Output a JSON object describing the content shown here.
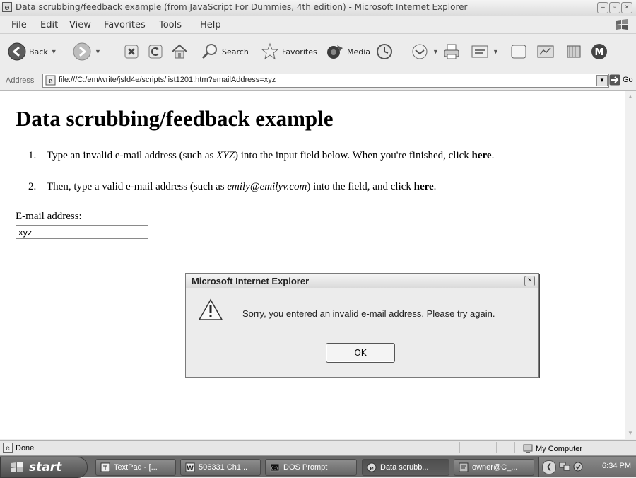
{
  "window": {
    "title": "Data scrubbing/feedback example (from JavaScript For Dummies, 4th edition) - Microsoft Internet Explorer"
  },
  "menu": {
    "items": [
      "File",
      "Edit",
      "View",
      "Favorites",
      "Tools",
      "Help"
    ]
  },
  "toolbar": {
    "back": "Back",
    "search": "Search",
    "favorites": "Favorites",
    "media": "Media"
  },
  "address": {
    "label": "Address",
    "url": "file:///C:/em/write/jsfd4e/scripts/list1201.htm?emailAddress=xyz",
    "go": "Go"
  },
  "page": {
    "title": "Data scrubbing/feedback example",
    "steps": [
      {
        "num": "1.",
        "pre": "Type an invalid e-mail address (such as ",
        "em": "XYZ",
        "mid": ") into the input field below. When you're finished, click ",
        "link": "here",
        "post": "."
      },
      {
        "num": "2.",
        "pre": "Then, type a valid e-mail address (such as ",
        "em": "emily@emilyv.com",
        "mid": ") into the field, and click ",
        "link": "here",
        "post": "."
      }
    ],
    "email_label": "E-mail address:",
    "email_value": "xyz"
  },
  "dialog": {
    "title": "Microsoft Internet Explorer",
    "message": "Sorry, you entered an invalid e-mail address.  Please try again.",
    "ok": "OK"
  },
  "status": {
    "text": "Done",
    "zone": "My Computer"
  },
  "taskbar": {
    "start": "start",
    "tasks": [
      {
        "label": "TextPad - [...",
        "active": false
      },
      {
        "label": "506331 Ch1...",
        "active": false
      },
      {
        "label": "DOS Prompt",
        "active": false
      },
      {
        "label": "Data scrubb...",
        "active": true
      },
      {
        "label": "owner@C_...",
        "active": false
      }
    ],
    "clock": "6:34 PM"
  }
}
